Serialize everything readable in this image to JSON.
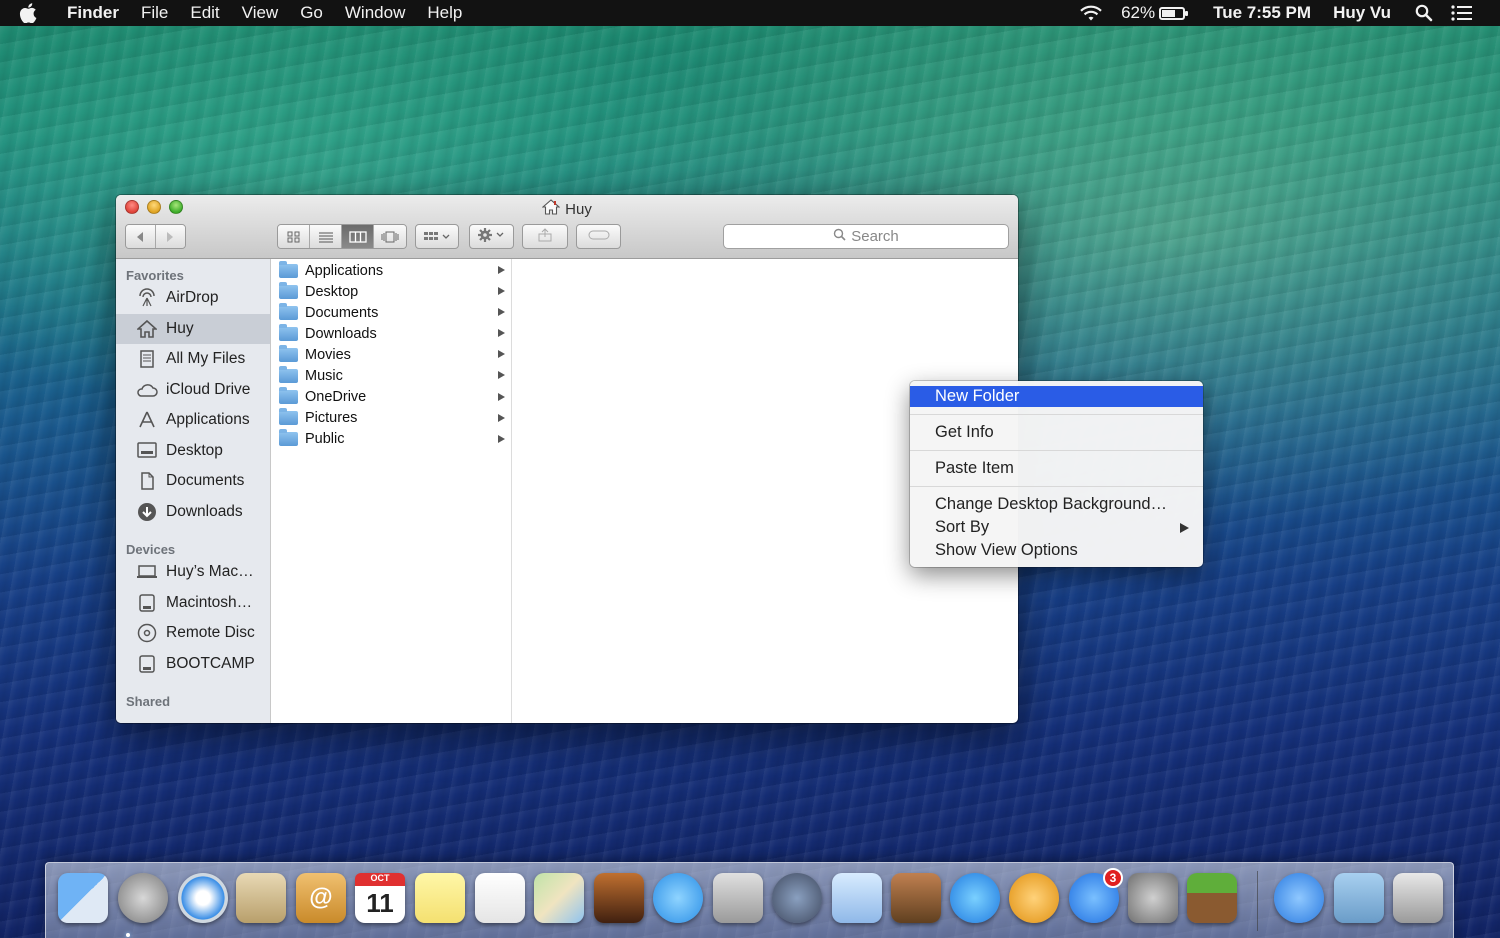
{
  "menubar": {
    "app_name": "Finder",
    "items": [
      "File",
      "Edit",
      "View",
      "Go",
      "Window",
      "Help"
    ],
    "battery_percent": "62%",
    "battery_level": 0.62,
    "clock": "Tue 7:55 PM",
    "user": "Huy Vu"
  },
  "window": {
    "title": "Huy",
    "search_placeholder": "Search",
    "view_mode": "columns"
  },
  "sidebar": {
    "favorites_header": "Favorites",
    "favorites": [
      {
        "label": "AirDrop",
        "icon": "airdrop-icon"
      },
      {
        "label": "Huy",
        "icon": "home-icon",
        "selected": true
      },
      {
        "label": "All My Files",
        "icon": "all-files-icon"
      },
      {
        "label": "iCloud Drive",
        "icon": "cloud-icon"
      },
      {
        "label": "Applications",
        "icon": "applications-icon"
      },
      {
        "label": "Desktop",
        "icon": "desktop-icon"
      },
      {
        "label": "Documents",
        "icon": "documents-icon"
      },
      {
        "label": "Downloads",
        "icon": "downloads-icon"
      }
    ],
    "devices_header": "Devices",
    "devices": [
      {
        "label": "Huy’s Mac…",
        "icon": "laptop-icon"
      },
      {
        "label": "Macintosh…",
        "icon": "disk-icon"
      },
      {
        "label": "Remote Disc",
        "icon": "disc-icon"
      },
      {
        "label": "BOOTCAMP",
        "icon": "disk-icon"
      }
    ],
    "shared_header": "Shared"
  },
  "column1": [
    "Applications",
    "Desktop",
    "Documents",
    "Downloads",
    "Movies",
    "Music",
    "OneDrive",
    "Pictures",
    "Public"
  ],
  "context_menu": {
    "items": [
      {
        "label": "New Folder",
        "highlighted": true
      },
      {
        "label": "Get Info"
      },
      {
        "label": "Paste Item"
      },
      {
        "label": "Change Desktop Background…"
      },
      {
        "label": "Sort By",
        "submenu": true
      },
      {
        "label": "Show View Options"
      }
    ]
  },
  "dock": {
    "app_store_badge": "3",
    "calendar_month": "OCT",
    "calendar_day": "11",
    "apps": [
      "finder-icon",
      "launchpad-icon",
      "safari-icon",
      "mail-icon",
      "contacts-icon",
      "calendar-icon",
      "notes-icon",
      "reminders-icon",
      "maps-icon",
      "photo-booth-icon",
      "messages-icon",
      "facetime-icon",
      "preview-icon",
      "numbers-icon",
      "keynote-icon",
      "itunes-icon",
      "ibooks-icon",
      "app-store-icon",
      "system-preferences-icon",
      "minecraft-icon",
      "applications-folder-icon",
      "downloads-folder-icon",
      "trash-icon"
    ]
  }
}
